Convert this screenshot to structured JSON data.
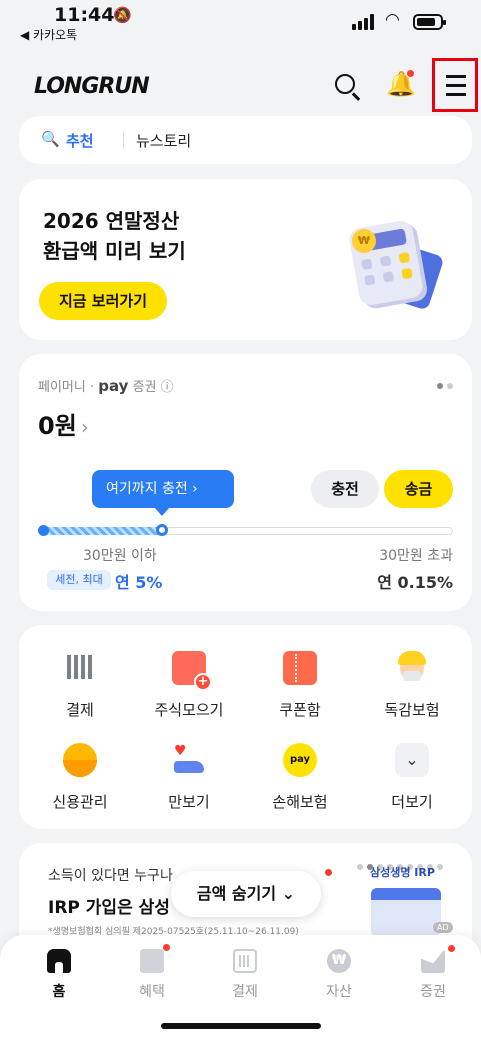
{
  "status_bar": {
    "time": "11:44",
    "back_app": "◀ 카카오톡"
  },
  "header": {
    "logo": "LONGRUN",
    "icons": [
      "search-icon",
      "bell-icon",
      "menu-icon"
    ]
  },
  "search": {
    "tag": "추천",
    "text": "뉴스토리"
  },
  "promo": {
    "title_line1": "2026 연말정산",
    "title_line2": "환급액 미리 보기",
    "cta": "지금 보러가기"
  },
  "money": {
    "brand_prefix": "페이머니 ·",
    "brand_pay": "pay",
    "brand_suffix": "증권",
    "info_icon": "ⓘ",
    "amount": "0원",
    "amount_chevron": "›",
    "tooltip": "여기까지 충전  ›",
    "charge": "충전",
    "send": "송금",
    "progress": 0.29,
    "low_label": "30만원 이하",
    "high_label": "30만원 초과",
    "badge": "세전, 최대",
    "rate_low": "연 5%",
    "rate_high": "연 0.15%"
  },
  "grid": [
    {
      "label": "결제",
      "icon": "barcode-icon"
    },
    {
      "label": "주식모으기",
      "icon": "stock-plus-icon"
    },
    {
      "label": "쿠폰함",
      "icon": "coupon-icon"
    },
    {
      "label": "독감보험",
      "icon": "flu-insurance-icon"
    },
    {
      "label": "신용관리",
      "icon": "credit-gauge-icon"
    },
    {
      "label": "만보기",
      "icon": "shoe-icon"
    },
    {
      "label": "손해보험",
      "icon": "pay-umbrella-icon"
    },
    {
      "label": "더보기",
      "icon": "chevron-down-icon"
    }
  ],
  "ad": {
    "line1": "소득이 있다면 누구나",
    "line2": "IRP 가입은 삼성",
    "fine": "*생명보험협회 심의필 제2025-07525호(25.11.10~26.11.09)",
    "brand": "삼성생명 IRP",
    "ad_tag": "AD"
  },
  "hide_amount": {
    "label": "금액 숨기기",
    "chevron": "⌄"
  },
  "nav": [
    {
      "label": "홈",
      "active": true
    },
    {
      "label": "혜택",
      "dot": true
    },
    {
      "label": "결제"
    },
    {
      "label": "자산"
    },
    {
      "label": "증권",
      "dot": true
    }
  ],
  "colors": {
    "accent_yellow": "#ffe100",
    "accent_blue": "#2a7cf4",
    "alert_red": "#ff3b30",
    "highlight_border": "#e60012"
  }
}
